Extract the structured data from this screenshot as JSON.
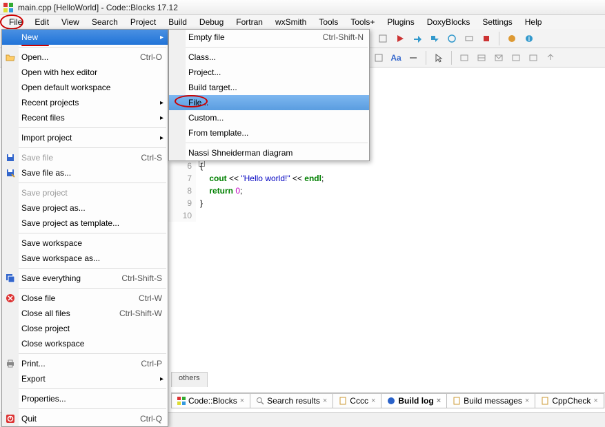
{
  "window": {
    "title": "main.cpp [HelloWorld] - Code::Blocks 17.12"
  },
  "menubar": [
    "File",
    "Edit",
    "View",
    "Search",
    "Project",
    "Build",
    "Debug",
    "Fortran",
    "wxSmith",
    "Tools",
    "Tools+",
    "Plugins",
    "DoxyBlocks",
    "Settings",
    "Help"
  ],
  "fileMenu": {
    "items": [
      {
        "type": "item",
        "label": "New",
        "highlight": true,
        "arrow": true
      },
      {
        "type": "sep"
      },
      {
        "type": "item",
        "icon": "open",
        "label": "Open...",
        "shortcut": "Ctrl-O"
      },
      {
        "type": "item",
        "label": "Open with hex editor"
      },
      {
        "type": "item",
        "label": "Open default workspace"
      },
      {
        "type": "item",
        "label": "Recent projects",
        "arrow": true
      },
      {
        "type": "item",
        "label": "Recent files",
        "arrow": true
      },
      {
        "type": "sep"
      },
      {
        "type": "item",
        "label": "Import project",
        "arrow": true
      },
      {
        "type": "sep"
      },
      {
        "type": "item",
        "icon": "save",
        "label": "Save file",
        "shortcut": "Ctrl-S",
        "disabled": true
      },
      {
        "type": "item",
        "icon": "saveas",
        "label": "Save file as..."
      },
      {
        "type": "sep"
      },
      {
        "type": "item",
        "label": "Save project",
        "disabled": true
      },
      {
        "type": "item",
        "label": "Save project as..."
      },
      {
        "type": "item",
        "label": "Save project as template..."
      },
      {
        "type": "sep"
      },
      {
        "type": "item",
        "label": "Save workspace"
      },
      {
        "type": "item",
        "label": "Save workspace as..."
      },
      {
        "type": "sep"
      },
      {
        "type": "item",
        "icon": "saveall",
        "label": "Save everything",
        "shortcut": "Ctrl-Shift-S"
      },
      {
        "type": "sep"
      },
      {
        "type": "item",
        "icon": "close",
        "label": "Close file",
        "shortcut": "Ctrl-W"
      },
      {
        "type": "item",
        "label": "Close all files",
        "shortcut": "Ctrl-Shift-W"
      },
      {
        "type": "item",
        "label": "Close project"
      },
      {
        "type": "item",
        "label": "Close workspace"
      },
      {
        "type": "sep"
      },
      {
        "type": "item",
        "icon": "print",
        "label": "Print...",
        "shortcut": "Ctrl-P"
      },
      {
        "type": "item",
        "label": "Export",
        "arrow": true
      },
      {
        "type": "sep"
      },
      {
        "type": "item",
        "label": "Properties..."
      },
      {
        "type": "sep"
      },
      {
        "type": "item",
        "icon": "quit",
        "label": "Quit",
        "shortcut": "Ctrl-Q"
      }
    ]
  },
  "newSubmenu": {
    "items": [
      {
        "type": "item",
        "label": "Empty file",
        "shortcut": "Ctrl-Shift-N"
      },
      {
        "type": "sep"
      },
      {
        "type": "item",
        "label": "Class..."
      },
      {
        "type": "item",
        "label": "Project..."
      },
      {
        "type": "item",
        "label": "Build target..."
      },
      {
        "type": "item",
        "label": "File...",
        "highlight": true,
        "circle": true
      },
      {
        "type": "item",
        "label": "Custom..."
      },
      {
        "type": "item",
        "label": "From template..."
      },
      {
        "type": "sep"
      },
      {
        "type": "item",
        "label": "Nassi Shneiderman diagram"
      }
    ]
  },
  "editor": {
    "lineStart": 6,
    "lines": [
      {
        "n": 6,
        "txt": "{",
        "cls": "brace"
      },
      {
        "n": 7,
        "txt": "    cout << \"Hello world!\" << endl;",
        "parts": [
          {
            "t": "    ",
            "c": ""
          },
          {
            "t": "cout",
            "c": "kw"
          },
          {
            "t": " << ",
            "c": "op"
          },
          {
            "t": "\"Hello world!\"",
            "c": "str"
          },
          {
            "t": " << ",
            "c": "op"
          },
          {
            "t": "endl",
            "c": "kw"
          },
          {
            "t": ";",
            "c": "op"
          }
        ]
      },
      {
        "n": 8,
        "txt": "    return 0;",
        "parts": [
          {
            "t": "    ",
            "c": ""
          },
          {
            "t": "return",
            "c": "kw"
          },
          {
            "t": " ",
            "c": ""
          },
          {
            "t": "0",
            "c": "num"
          },
          {
            "t": ";",
            "c": "op"
          }
        ]
      },
      {
        "n": 9,
        "txt": "}",
        "cls": "brace"
      },
      {
        "n": 10,
        "txt": "",
        "cls": ""
      }
    ]
  },
  "intermediateTab": "others",
  "bottomTabs": [
    {
      "label": "Code::Blocks",
      "icon": "cb"
    },
    {
      "label": "Search results",
      "icon": "search"
    },
    {
      "label": "Cccc",
      "icon": "doc"
    },
    {
      "label": "Build log",
      "icon": "blue",
      "active": true
    },
    {
      "label": "Build messages",
      "icon": "doc"
    },
    {
      "label": "CppCheck",
      "icon": "doc",
      "partial": true
    }
  ]
}
